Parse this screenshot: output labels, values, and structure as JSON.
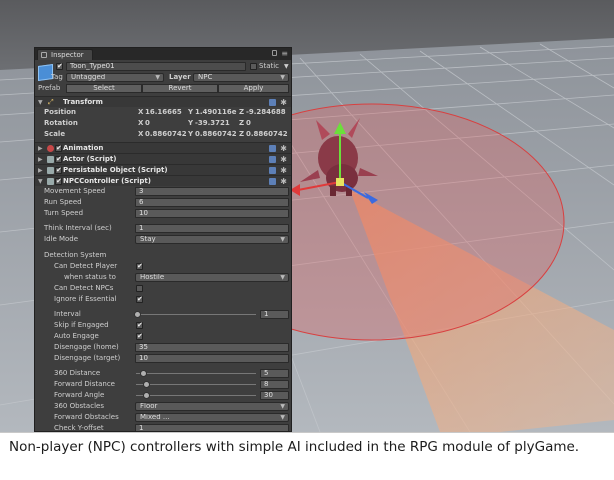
{
  "inspector": {
    "tab_title": "Inspector",
    "object_name": "Toon_Type01",
    "static_label": "Static",
    "tag_label": "Tag",
    "tag_value": "Untagged",
    "layer_label": "Layer",
    "layer_value": "NPC",
    "prefab_label": "Prefab",
    "select_label": "Select",
    "revert_label": "Revert",
    "apply_label": "Apply"
  },
  "transform": {
    "title": "Transform",
    "position_label": "Position",
    "rotation_label": "Rotation",
    "scale_label": "Scale",
    "x": "X",
    "y": "Y",
    "z": "Z",
    "pos_x": "16.16665",
    "pos_y": "1.490116e",
    "pos_z": "-9.284688",
    "rot_x": "0",
    "rot_y": "-39.3721",
    "rot_z": "0",
    "scale_x": "0.8860742",
    "scale_y": "0.8860742",
    "scale_z": "0.8860742"
  },
  "components": {
    "animation": "Animation",
    "actor": "Actor (Script)",
    "persistable": "Persistable Object (Script)",
    "npc_controller": "NPCController (Script)"
  },
  "npc": {
    "movement_speed_label": "Movement Speed",
    "movement_speed": "3",
    "run_speed_label": "Run Speed",
    "run_speed": "6",
    "turn_speed_label": "Turn Speed",
    "turn_speed": "10",
    "think_interval_label": "Think Interval (sec)",
    "think_interval": "1",
    "idle_mode_label": "Idle Mode",
    "idle_mode": "Stay",
    "detection_system_label": "Detection System",
    "can_detect_player_label": "Can Detect Player",
    "can_detect_player": true,
    "when_status_label": "when status to",
    "when_status": "Hostile",
    "can_detect_npcs_label": "Can Detect NPCs",
    "can_detect_npcs": false,
    "ignore_essential_label": "Ignore if Essential",
    "ignore_essential": true,
    "interval_label": "Interval",
    "interval": "1",
    "interval_slider": 0,
    "skip_engaged_label": "Skip if Engaged",
    "skip_engaged": true,
    "auto_engage_label": "Auto Engage",
    "auto_engage": true,
    "disengage_home_label": "Disengage (home)",
    "disengage_home": "35",
    "disengage_target_label": "Disengage (target)",
    "disengage_target": "10",
    "distance_360_label": "360 Distance",
    "distance_360": "5",
    "distance_360_slider": 0.05,
    "forward_distance_label": "Forward Distance",
    "forward_distance": "8",
    "forward_distance_slider": 0.08,
    "forward_angle_label": "Forward Angle",
    "forward_angle": "30",
    "forward_angle_slider": 0.08,
    "obstacles_360_label": "360 Obstacles",
    "obstacles_360": "Floor",
    "forward_obstacles_label": "Forward Obstacles",
    "forward_obstacles": "Mixed ...",
    "check_y_offset_label": "Check Y-offset",
    "check_y_offset": "1"
  },
  "caption": {
    "text": "Non-player (NPC) controllers with simple AI included in the RPG module of plyGame."
  },
  "colors": {
    "panel_bg": "#3e3e3e",
    "detection_circle": "#e66060",
    "detection_cone": "#f0a070",
    "floor": "#a7acb3",
    "sky": "#5f6063"
  }
}
